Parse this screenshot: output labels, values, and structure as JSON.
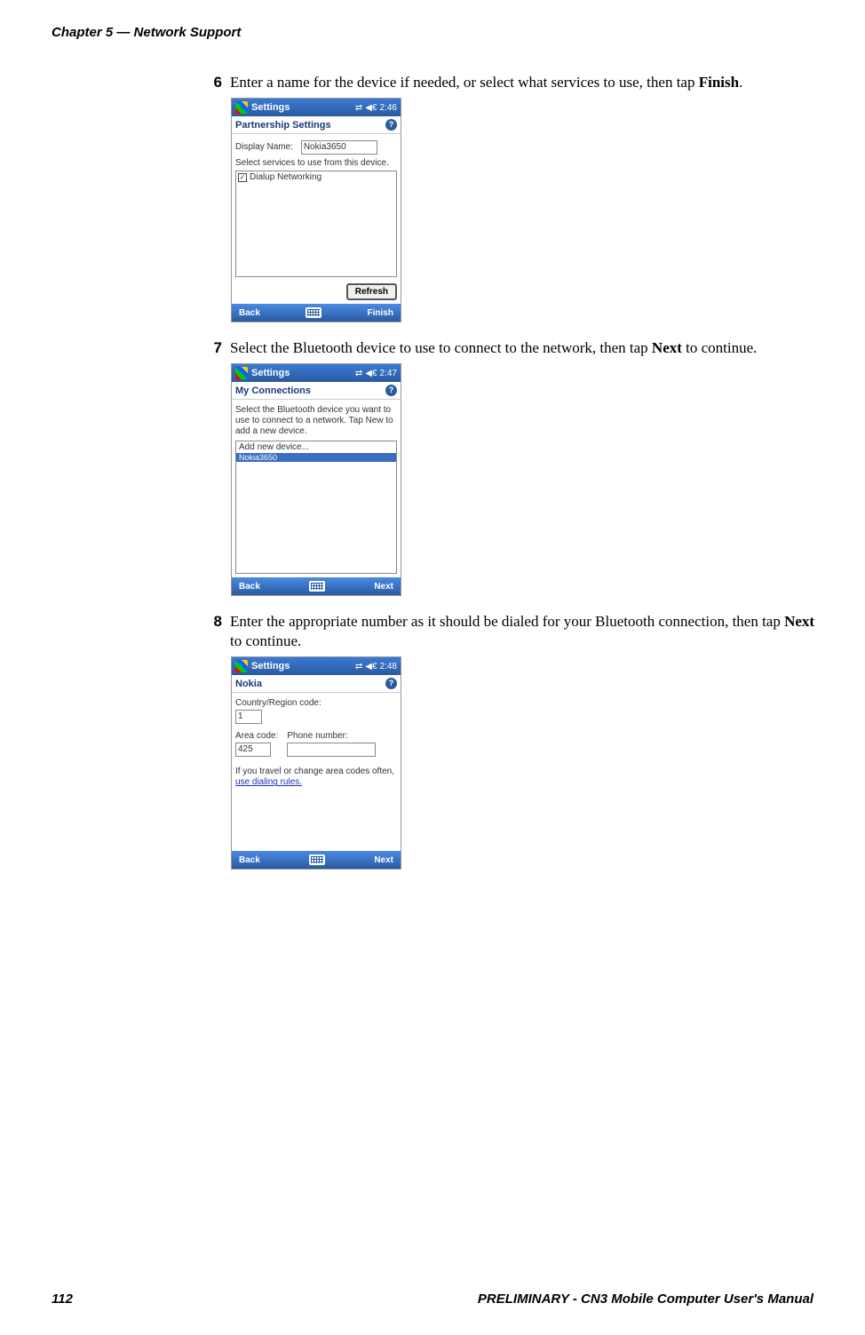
{
  "header": {
    "chapter": "Chapter 5 — Network Support"
  },
  "footer": {
    "page": "112",
    "manual": "PRELIMINARY - CN3 Mobile Computer User's Manual"
  },
  "steps": [
    {
      "num": "6",
      "text_a": "Enter a name for the device if needed, or select what services to use, then tap ",
      "text_b": "Finish",
      "text_c": "."
    },
    {
      "num": "7",
      "text_a": "Select the Bluetooth device to use to connect to the network, then tap ",
      "text_b": "Next",
      "text_c": " to continue."
    },
    {
      "num": "8",
      "text_a": "Enter the appropriate number as it should be dialed for your Bluetooth connection, then tap ",
      "text_b": "Next",
      "text_c": " to continue."
    }
  ],
  "ss1": {
    "title": "Settings",
    "time": "2:46",
    "subtitle": "Partnership Settings",
    "label_display": "Display Name:",
    "value_display": "Nokia3650",
    "label_services": "Select services to use from this device.",
    "service_item": "Dialup Networking",
    "btn_refresh": "Refresh",
    "btn_back": "Back",
    "btn_finish": "Finish"
  },
  "ss2": {
    "title": "Settings",
    "time": "2:47",
    "subtitle": "My Connections",
    "instructions": "Select the Bluetooth device you want to use to connect to a network. Tap New to add a new device.",
    "item_new": "Add new device...",
    "item_sel": "Nokia3650",
    "btn_back": "Back",
    "btn_next": "Next"
  },
  "ss3": {
    "title": "Settings",
    "time": "2:48",
    "subtitle": "Nokia",
    "label_country": "Country/Region code:",
    "value_country": "1",
    "label_area": "Area code:",
    "value_area": "425",
    "label_phone": "Phone number:",
    "value_phone": "",
    "tip_prefix": "If you travel or change area codes often, ",
    "tip_link": "use dialing rules.",
    "btn_back": "Back",
    "btn_next": "Next"
  }
}
